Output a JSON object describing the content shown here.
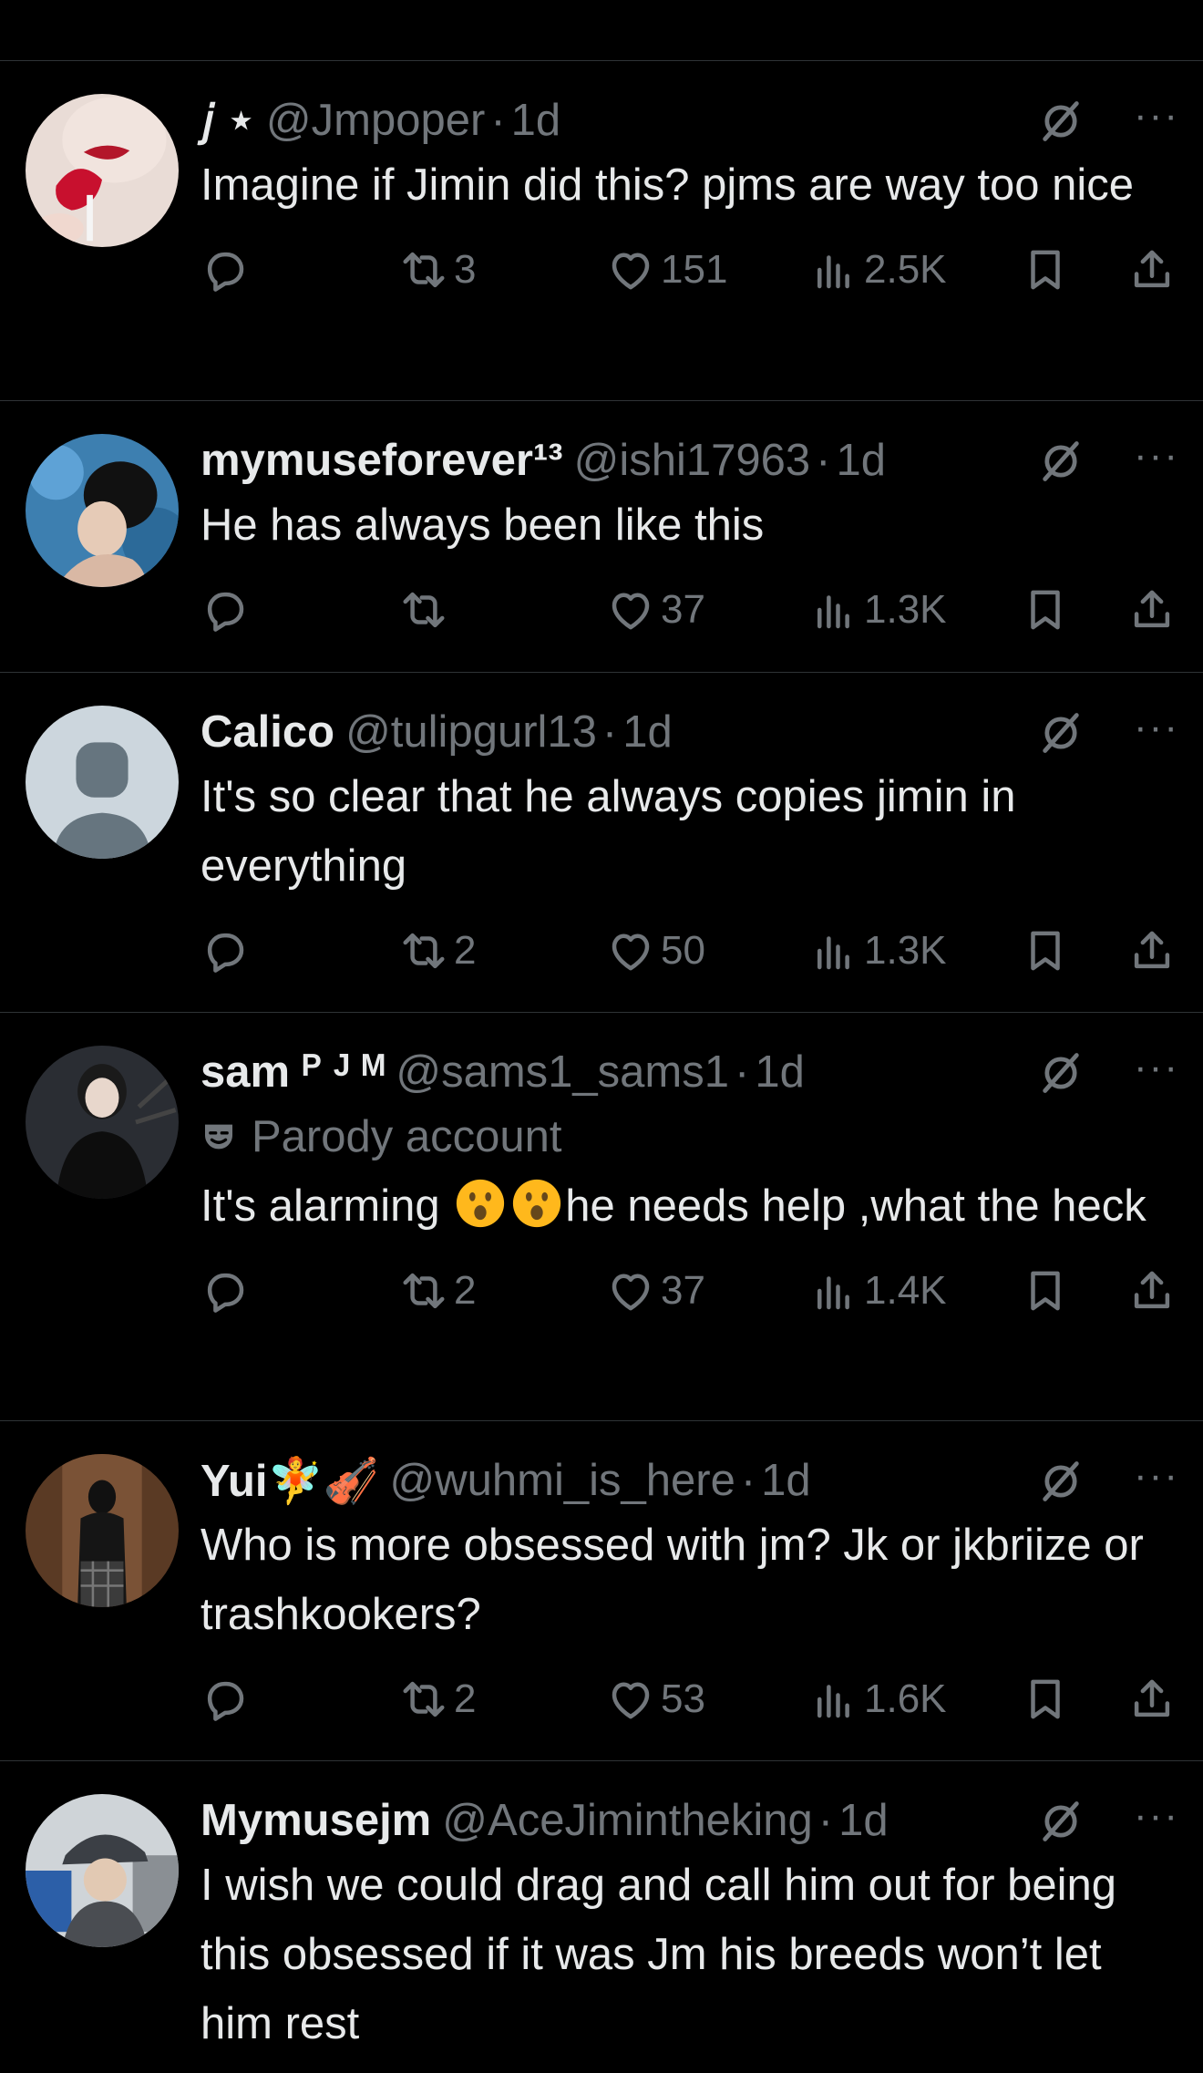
{
  "tweets": [
    {
      "name": "𝑗 ⋆",
      "handle": "@Jmpoper",
      "time": "1d",
      "badge": "",
      "text": "Imagine if Jimin did this? pjms are way too nice",
      "replies": "",
      "reposts": "3",
      "likes": "151",
      "views": "2.5K"
    },
    {
      "name": "mymuseforever¹³",
      "handle": "@ishi17963",
      "time": "1d",
      "badge": "",
      "text": "He has always been like this",
      "replies": "",
      "reposts": "",
      "likes": "37",
      "views": "1.3K"
    },
    {
      "name": "Calico",
      "handle": "@tulipgurl13",
      "time": "1d",
      "badge": "",
      "text": "It's so clear that he always copies jimin in everything",
      "replies": "",
      "reposts": "2",
      "likes": "50",
      "views": "1.3K"
    },
    {
      "name": "sam ᴾ ᴶ ᴹ",
      "handle": "@sams1_sams1",
      "time": "1d",
      "badge": "Parody account",
      "text_before": "It's alarming ",
      "text_emoji": "😮😮",
      "text_after": "he needs help ,what the heck",
      "replies": "",
      "reposts": "2",
      "likes": "37",
      "views": "1.4K"
    },
    {
      "name": "Yui🧚🎻",
      "handle": "@wuhmi_is_here",
      "time": "1d",
      "badge": "",
      "text": "Who is more obsessed with jm? Jk or jkbriize or trashkookers?",
      "replies": "",
      "reposts": "2",
      "likes": "53",
      "views": "1.6K"
    },
    {
      "name": "Mymusejm",
      "handle": "@AceJimintheking",
      "time": "1d",
      "badge": "",
      "text": "I wish we could drag and call him out for being this obsessed if it was Jm his breeds won’t let him rest",
      "replies": "",
      "reposts": "",
      "likes": "",
      "views": ""
    }
  ],
  "separator": "·",
  "more_label": "···",
  "colors": {
    "background": "#000000",
    "text_primary": "#e7e9ea",
    "text_secondary": "#71767b",
    "divider": "#2f3336"
  }
}
